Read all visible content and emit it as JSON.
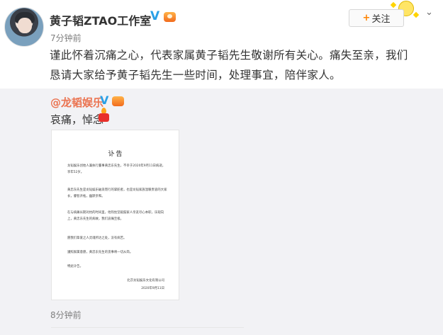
{
  "user": {
    "name": "黄子韬ZTAO工作室",
    "verified_mark": "V",
    "time": "7分钟前"
  },
  "actions": {
    "follow_label": "关注",
    "follow_plus": "+",
    "more_glyph": "⌄"
  },
  "post": {
    "text": "谨此怀着沉痛之心，代表家属黄子韬先生敬谢所有关心。痛失至亲，我们恳请大家给予黄子韬先生一些时间，处理事宜，陪伴家人。"
  },
  "repost": {
    "author": "@龙韬娱乐",
    "verified_mark": "V",
    "text": "哀痛，悼念",
    "time": "8分钟前",
    "notice": {
      "title": "讣告",
      "paragraphs": [
        "龙韬娱乐创始人兼执行董事黄忠东先生，不幸于2020年9月11日病逝，享年52岁。",
        "黄忠东先生是龙韬娱乐破浪而行的掌舵者，也是龙韬家族温暖贵容的大家长，睿智开拓，幽默亲和。",
        "在与病痛长期对抗的时间里，他热忱坚毅鼓家人亲友尽心本职，乐观向上，黄忠东先生的病故，我们哀痛至极。",
        "愿我们挚爱之人灵魂所达之处，没有病苦。",
        "遵照家属意愿，黄忠东先生的丧事将一切从简。",
        "特此讣告。"
      ],
      "signature_org": "北京龙韬娱乐文化有限公司",
      "signature_date": "2020年9月11日"
    }
  },
  "icons": {
    "avatar": "avatar-photo",
    "verified": "verified-v-icon",
    "vip": "vip-badge-icon",
    "candle": "candle-icon",
    "chevron": "chevron-down-icon",
    "decoration": "sticker-decoration"
  },
  "colors": {
    "accent_orange": "#ff8200",
    "link": "#eb7350",
    "verified_blue": "#2aa0e6",
    "repost_bg": "#f2f2f5",
    "meta_gray": "#808080"
  }
}
